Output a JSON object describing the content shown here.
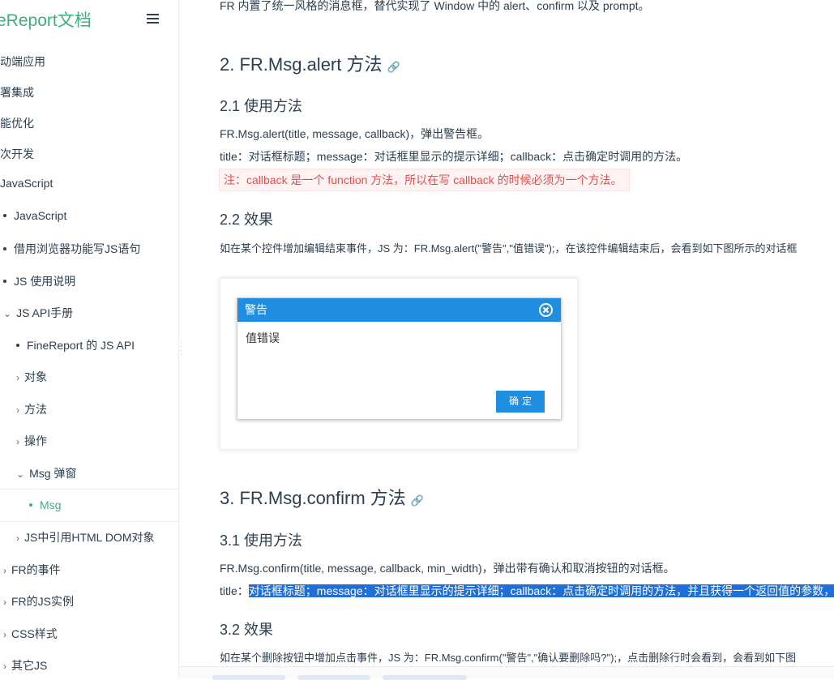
{
  "sidebar": {
    "brand": "eReport文档",
    "items": [
      {
        "label": "动端应用"
      },
      {
        "label": "署集成"
      },
      {
        "label": "能优化"
      },
      {
        "label": "次开发"
      },
      {
        "label": "JavaScript"
      },
      {
        "label": "JavaScript"
      },
      {
        "label": "借用浏览器功能写JS语句"
      },
      {
        "label": "JS 使用说明"
      },
      {
        "label": "JS API手册"
      },
      {
        "label": "FineReport 的 JS API"
      },
      {
        "label": "对象"
      },
      {
        "label": "方法"
      },
      {
        "label": "操作"
      },
      {
        "label": "Msg 弹窗"
      },
      {
        "label": "Msg"
      },
      {
        "label": "JS中引用HTML DOM对象"
      },
      {
        "label": "FR的事件"
      },
      {
        "label": "FR的JS实例"
      },
      {
        "label": "CSS样式"
      },
      {
        "label": "其它JS"
      }
    ]
  },
  "content": {
    "intro": "FR 内置了统一风格的消息框，替代实现了 Window 中的 alert、confirm 以及 prompt。",
    "h2_alert": "2. FR.Msg.alert 方法",
    "h3_alert_usage": "2.1 使用方法",
    "alert_sig": "FR.Msg.alert(title, message, callback)，弹出警告框。",
    "alert_params": "title：对话框标题；message：对话框里显示的提示详细；callback：点击确定时调用的方法。",
    "alert_note": "注：callback 是一个 function 方法，所以在写 callback 的时候必须为一个方法。",
    "h3_alert_effect": "2.2 效果",
    "alert_effect_text": "如在某个控件增加编辑结束事件，JS 为：FR.Msg.alert(\"警告\",\"值错误\");，在该控件编辑结束后，会看到如下图所示的对话框",
    "dialog": {
      "title": "警告",
      "message": "值错误",
      "ok": "确定"
    },
    "h2_confirm": "3. FR.Msg.confirm 方法",
    "h3_confirm_usage": "3.1 使用方法",
    "confirm_sig": "FR.Msg.confirm(title, message, callback, min_width)，弹出带有确认和取消按钮的对话框。",
    "confirm_params_prefix": "title：",
    "confirm_params_selected": "对话框标题；message：对话框里显示的提示详细；callback：点击确定时调用的方法，并且获得一个返回值的参数，",
    "h3_confirm_effect": "3.2 效果",
    "confirm_effect_text": "如在某个删除按钮中增加点击事件，JS 为：FR.Msg.confirm(\"警告\",\"确认要删除吗?\");，点击删除行时会看到，会看到如下图"
  },
  "colors": {
    "accent": "#3eaf7c",
    "dialog_blue": "#1f8de0",
    "note_red": "#e04f4f",
    "selection": "#1e6fd9"
  }
}
